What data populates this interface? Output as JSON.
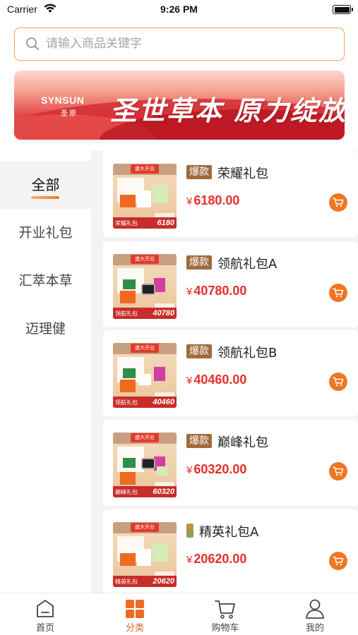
{
  "status_bar": {
    "carrier": "Carrier",
    "time": "9:26 PM"
  },
  "search": {
    "placeholder": "请输入商品关键字"
  },
  "banner": {
    "brand_en": "SYNSUN",
    "brand_cn": "圣原",
    "slogan": "圣世草本 原力绽放"
  },
  "sidebar": {
    "categories": [
      {
        "label": "全部",
        "active": true
      },
      {
        "label": "开业礼包",
        "active": false
      },
      {
        "label": "汇萃本草",
        "active": false
      },
      {
        "label": "迈理健",
        "active": false
      }
    ]
  },
  "products": [
    {
      "tag": "爆款",
      "name": "荣耀礼包",
      "currency": "¥",
      "price": "6180.00",
      "thumb_name": "荣耀礼包",
      "thumb_price": "6180"
    },
    {
      "tag": "爆款",
      "name": "领航礼包A",
      "currency": "¥",
      "price": "40780.00",
      "thumb_name": "领航礼包",
      "thumb_price": "40780"
    },
    {
      "tag": "爆款",
      "name": "领航礼包B",
      "currency": "¥",
      "price": "40460.00",
      "thumb_name": "领航礼包",
      "thumb_price": "40460"
    },
    {
      "tag": "爆款",
      "name": "巅峰礼包",
      "currency": "¥",
      "price": "60320.00",
      "thumb_name": "巅峰礼包",
      "thumb_price": "60320"
    },
    {
      "tag": "",
      "name": "精英礼包A",
      "currency": "¥",
      "price": "20620.00",
      "thumb_name": "精英礼包",
      "thumb_price": "20620"
    }
  ],
  "thumb_badge": "盛大开业",
  "tabbar": {
    "items": [
      {
        "label": "首页",
        "icon": "home-icon",
        "active": false
      },
      {
        "label": "分类",
        "icon": "category-icon",
        "active": true
      },
      {
        "label": "购物车",
        "icon": "cart-icon",
        "active": false
      },
      {
        "label": "我的",
        "icon": "user-icon",
        "active": false
      }
    ]
  },
  "colors": {
    "accent": "#f07624",
    "price": "#e5302a",
    "tag": "#a06a3c",
    "search_border": "#f0a15f"
  }
}
